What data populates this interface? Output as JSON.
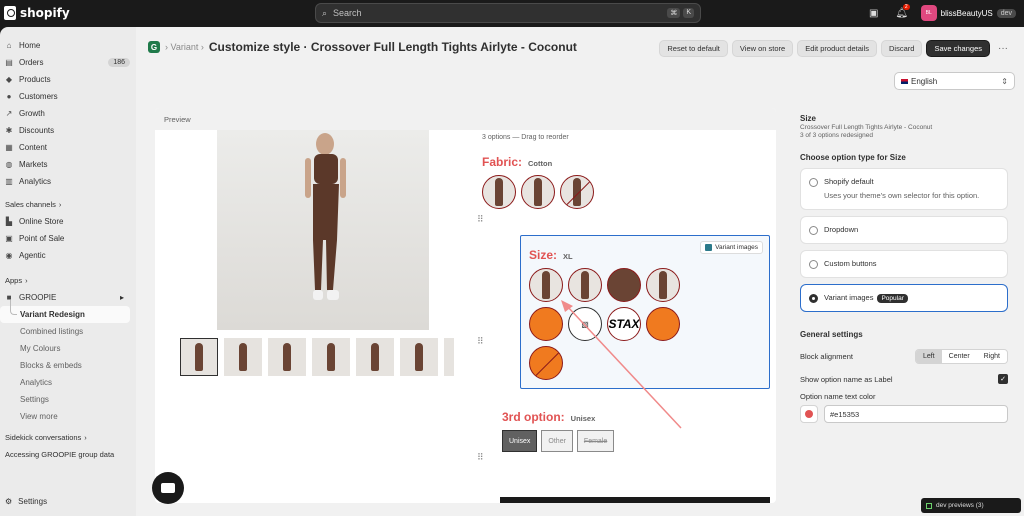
{
  "topbar": {
    "logo": "shopify",
    "search_placeholder": "Search",
    "kbd": [
      "⌘",
      "K"
    ],
    "notif_count": "2",
    "store_initials": "BL",
    "store_name": "blissBeautyUS",
    "store_badge": "dev"
  },
  "sidebar": {
    "items": [
      {
        "label": "Home",
        "icon": "home-icon"
      },
      {
        "label": "Orders",
        "icon": "orders-icon",
        "count": "186"
      },
      {
        "label": "Products",
        "icon": "tag-icon"
      },
      {
        "label": "Customers",
        "icon": "person-icon"
      },
      {
        "label": "Growth",
        "icon": "growth-icon"
      },
      {
        "label": "Discounts",
        "icon": "discount-icon"
      },
      {
        "label": "Content",
        "icon": "content-icon"
      },
      {
        "label": "Markets",
        "icon": "globe-icon"
      },
      {
        "label": "Analytics",
        "icon": "chart-icon"
      }
    ],
    "sales_channels_label": "Sales channels",
    "channels": [
      {
        "label": "Online Store",
        "icon": "store-icon"
      },
      {
        "label": "Point of Sale",
        "icon": "pos-icon"
      },
      {
        "label": "Agentic",
        "icon": "agentic-icon"
      }
    ],
    "apps_label": "Apps",
    "app_name": "GROOPIE",
    "app_sub": [
      "Variant Redesign",
      "Combined listings",
      "My Colours",
      "Blocks & embeds",
      "Analytics",
      "Settings",
      "View more"
    ],
    "sidekick_label": "Sidekick conversations",
    "sidekick_item": "Accessing GROOPIE group data",
    "settings_label": "Settings"
  },
  "header": {
    "crumb": "Variant",
    "title": "Customize style · Crossover Full Length Tights Airlyte - Coconut",
    "buttons": [
      "Reset to default",
      "View on store",
      "Edit product details",
      "Discard"
    ],
    "primary": "Save changes",
    "more": "···"
  },
  "language": {
    "value": "English"
  },
  "preview": {
    "label": "Preview",
    "hint": "3 options — Drag to reorder",
    "fabric": {
      "name": "Fabric:",
      "value": "Cotton"
    },
    "size": {
      "name": "Size:",
      "value": "XL",
      "badge": "Variant images",
      "stax": "STAX"
    },
    "third": {
      "name": "3rd option:",
      "value": "Unisex",
      "tags": [
        "Unisex",
        "Other",
        "Female"
      ]
    }
  },
  "panel": {
    "title": "Size",
    "product": "Crossover Full Length Tights Airlyte - Coconut",
    "redesigned": "3 of 3 options redesigned",
    "choose": "Choose option type for Size",
    "types": [
      {
        "label": "Shopify default",
        "desc": "Uses your theme's own selector for this option."
      },
      {
        "label": "Dropdown"
      },
      {
        "label": "Custom buttons"
      },
      {
        "label": "Variant images",
        "badge": "Popular"
      }
    ],
    "general": "General settings",
    "block_alignment": "Block alignment",
    "align": [
      "Left",
      "Center",
      "Right"
    ],
    "show_label": "Show option name as Label",
    "text_color_label": "Option name text color",
    "text_color": "#e15353"
  },
  "dev_previews": "dev previews (3)"
}
